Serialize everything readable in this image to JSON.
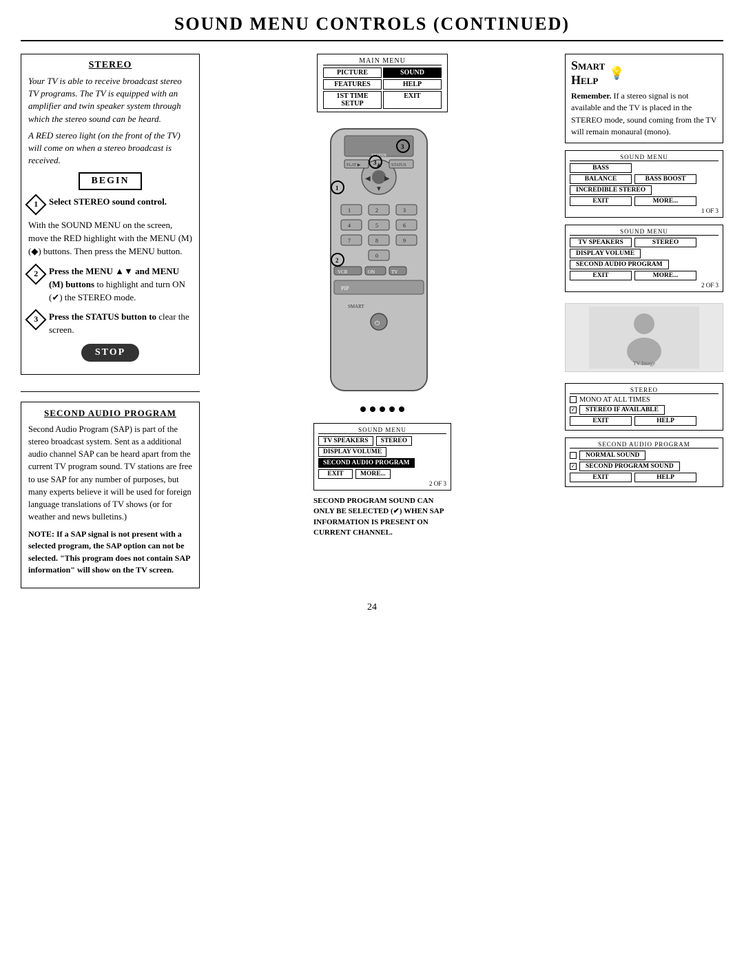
{
  "page": {
    "title": "Sound Menu Controls (Continued)",
    "page_number": "24"
  },
  "stereo_section": {
    "title": "STEREO",
    "paragraphs": [
      "Your TV is able to receive broadcast stereo TV programs. The TV is equipped with an amplifier and twin speaker system through which the stereo sound can be heard.",
      "A RED stereo light (on the front of the TV) will come on when a stereo broadcast is received."
    ],
    "begin_label": "BEGIN",
    "steps": [
      {
        "num": "1",
        "type": "diamond",
        "text": "Select STEREO sound control."
      },
      {
        "num": "",
        "type": "plain",
        "text": "With the SOUND MENU on the screen, move the RED highlight with the MENU (M) (◆) buttons. Then press the MENU button."
      },
      {
        "num": "2",
        "type": "diamond",
        "text": "Press the MENU ▲▼ and MENU (M) buttons to highlight and turn ON (✔) the STEREO mode."
      },
      {
        "num": "3",
        "type": "diamond",
        "text": "Press the STATUS button to clear the screen."
      }
    ],
    "stop_label": "STOP"
  },
  "smart_help": {
    "title": "Smart Help",
    "smart_word": "Smart",
    "help_word": "Help",
    "icon": "💡",
    "remember_label": "Remember.",
    "text": "If a stereo signal is not available and the TV is placed in the STEREO mode, sound coming from the TV will remain monaural (mono)."
  },
  "sound_menu_1": {
    "title": "SOUND MENU",
    "rows": [
      "BASS",
      "BALANCE",
      "BASS BOOST",
      "INCREDIBLE STEREO",
      "EXIT",
      "MORE..."
    ],
    "footer": "1 OF 3"
  },
  "sound_menu_2": {
    "title": "SOUND MENU",
    "rows": [
      "TV SPEAKERS",
      "STEREO",
      "DISPLAY VOLUME",
      "SECOND AUDIO PROGRAM",
      "EXIT",
      "MORE..."
    ],
    "footer": "2 OF 3"
  },
  "sound_menu_3": {
    "title": "STEREO",
    "rows": [
      "MONO AT ALL TIMES",
      "STEREO IF AVAILABLE"
    ],
    "exit_label": "EXIT",
    "help_label": "HELP"
  },
  "sap_section": {
    "title": "SECOND AUDIO PROGRAM",
    "paragraphs": [
      "Second Audio Program (SAP) is part of the stereo broadcast system. Sent as a additional audio channel SAP can be heard apart from the current TV program sound. TV stations are free to use SAP for any number of purposes, but many experts believe it will be used for foreign language translations of TV shows (or for weather and news bulletins.)",
      "NOTE: If a SAP signal is not present with a selected program, the SAP option can not be selected. \"This program does not contain SAP information\" will show on the TV screen."
    ]
  },
  "bottom_center": {
    "menu_title": "SOUND MENU",
    "tv_speakers_label": "TV SPEAKERS",
    "stereo_label": "STEREO",
    "display_volume_label": "DISPLAY VOLUME",
    "sap_label": "SECOND AUDIO PROGRAM",
    "exit_label": "EXIT",
    "more_label": "MORE...",
    "footer": "2 OF 3",
    "caption": "SECOND PROGRAM SOUND CAN ONLY BE SELECTED (✔) WHEN SAP INFORMATION IS PRESENT ON CURRENT CHANNEL."
  },
  "bottom_right": {
    "title": "SECOND AUDIO PROGRAM",
    "normal_sound": "NORMAL SOUND",
    "second_program": "SECOND PROGRAM SOUND",
    "exit_label": "EXIT",
    "help_label": "HELP"
  },
  "main_menu": {
    "title": "MAIN MENU",
    "buttons": [
      "PICTURE",
      "SOUND",
      "FEATURES",
      "HELP",
      "1ST TIME SETUP",
      "EXIT"
    ]
  }
}
